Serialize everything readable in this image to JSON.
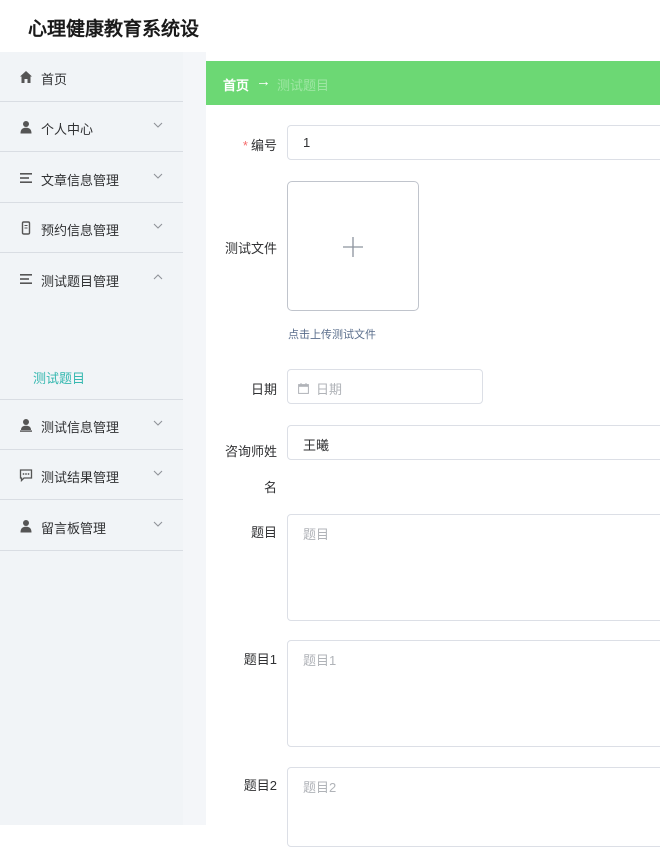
{
  "app": {
    "title": "心理健康教育系统设"
  },
  "sidebar": {
    "items": [
      {
        "label": "首页",
        "icon": "home-icon"
      },
      {
        "label": "个人中心",
        "icon": "user-icon",
        "expanded": false
      },
      {
        "label": "文章信息管理",
        "icon": "list-icon",
        "expanded": false
      },
      {
        "label": "预约信息管理",
        "icon": "phone-icon",
        "expanded": false
      },
      {
        "label": "测试题目管理",
        "icon": "list-icon",
        "expanded": true,
        "children": [
          {
            "label": "测试题目",
            "active": true
          }
        ]
      },
      {
        "label": "测试信息管理",
        "icon": "user-check-icon",
        "expanded": false
      },
      {
        "label": "测试结果管理",
        "icon": "chat-icon",
        "expanded": false
      },
      {
        "label": "留言板管理",
        "icon": "user-icon",
        "expanded": false
      }
    ]
  },
  "breadcrumb": {
    "home": "首页",
    "separator": "→",
    "current": "测试题目"
  },
  "form": {
    "number": {
      "label": "编号",
      "required": "*",
      "value": "1"
    },
    "test_file": {
      "label": "测试文件",
      "upload_hint": "点击上传测试文件",
      "upload_symbol": "+"
    },
    "date": {
      "label": "日期",
      "placeholder": "日期"
    },
    "counselor": {
      "label_line1": "咨询师姓",
      "label_line2": "名",
      "value": "王曦"
    },
    "question": {
      "label": "题目",
      "placeholder": "题目"
    },
    "question1": {
      "label": "题目1",
      "placeholder": "题目1"
    },
    "question2": {
      "label": "题目2",
      "placeholder": "题目2"
    }
  },
  "colors": {
    "accent_green": "#6cd874",
    "submenu_active": "#36b8b0",
    "required": "#f56c6c",
    "sidebar_bg": "#f1f4f7"
  }
}
